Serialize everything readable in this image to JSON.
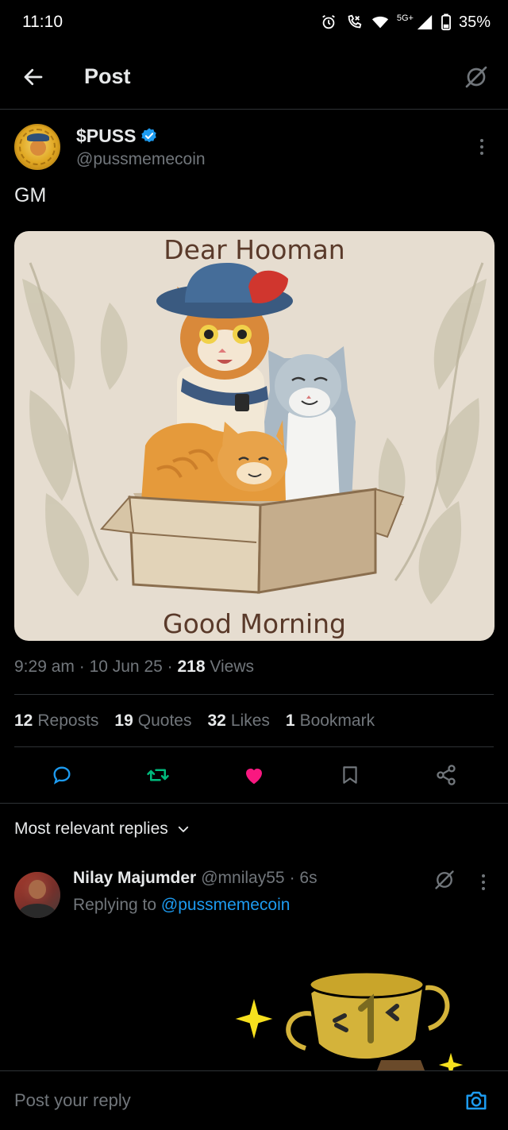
{
  "status_bar": {
    "time": "11:10",
    "network": "5G+",
    "battery": "35%"
  },
  "header": {
    "title": "Post"
  },
  "post": {
    "author_name": "$PUSS",
    "author_handle": "@pussmemecoin",
    "text": "GM",
    "image": {
      "caption_top": "Dear Hooman",
      "caption_bottom": "Good Morning"
    },
    "meta": {
      "time": "9:29 am",
      "date": "10 Jun 25",
      "views_count": "218",
      "views_label": "Views"
    },
    "stats": [
      {
        "count": "12",
        "label": "Reposts"
      },
      {
        "count": "19",
        "label": "Quotes"
      },
      {
        "count": "32",
        "label": "Likes"
      },
      {
        "count": "1",
        "label": "Bookmark"
      }
    ],
    "actions": {
      "reply_icon": "reply-icon",
      "repost_icon": "repost-icon",
      "like_icon": "heart-icon",
      "bookmark_icon": "bookmark-icon",
      "share_icon": "share-icon",
      "repost_color": "#00ba7c",
      "like_color": "#f91880"
    }
  },
  "replies": {
    "sort_label": "Most relevant replies",
    "items": [
      {
        "name": "Nilay Majumder",
        "handle": "@mnilay55",
        "time": "· 6s",
        "replying_prefix": "Replying to",
        "replying_mention": "@pussmemecoin"
      }
    ]
  },
  "compose": {
    "placeholder": "Post your reply"
  },
  "colors": {
    "background": "#000000",
    "accent": "#1d9bf0",
    "text_primary": "#e7e9ea",
    "text_secondary": "#71767b",
    "divider": "#2f3336"
  }
}
